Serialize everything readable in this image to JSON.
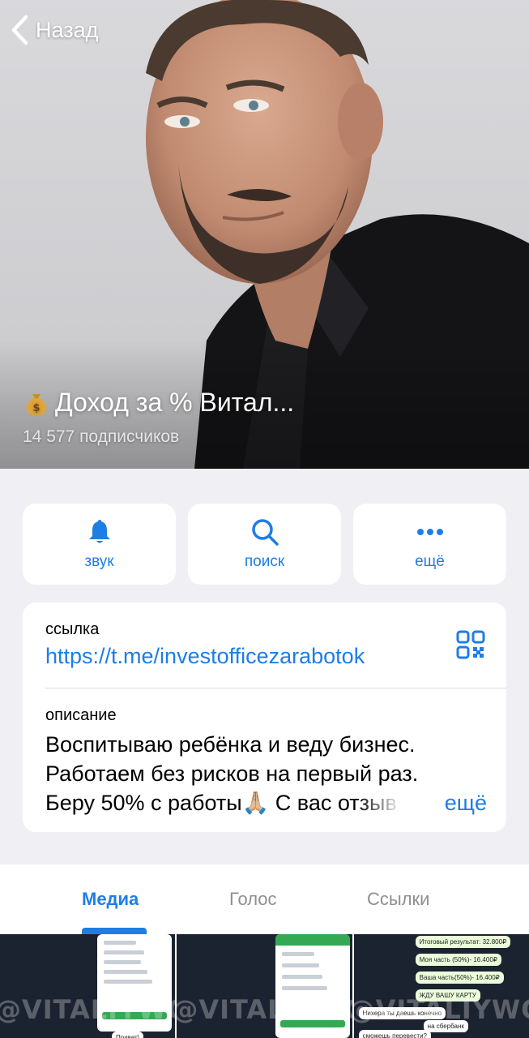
{
  "nav": {
    "back_label": "Назад"
  },
  "channel": {
    "title": "Доход за % Витал...",
    "subscribers": "14 577 подписчиков",
    "title_emoji": "money-bag-icon"
  },
  "actions": [
    {
      "label": "звук",
      "icon": "bell-icon"
    },
    {
      "label": "поиск",
      "icon": "search-icon"
    },
    {
      "label": "ещё",
      "icon": "more-dots-icon"
    }
  ],
  "info": {
    "link_caption": "ссылка",
    "link": "https://t.me/investofficezarabotok",
    "description_caption": "описание",
    "description_lines": [
      "Воспитываю ребёнка и веду бизнес.",
      "Работаем без рисков на первый раз.",
      "Беру 50% с работы🙏🏼 С вас отзыв"
    ],
    "more_label": "ещё"
  },
  "tabs": [
    {
      "label": "Медиа",
      "active": true
    },
    {
      "label": "Голос",
      "active": false
    },
    {
      "label": "Ссылки",
      "active": false
    }
  ],
  "media": {
    "watermark": "@VITALIYWORK",
    "thumb3_lines": [
      "Итоговый результат: 32.800₽",
      "Моя часть (50%)- 16.400₽",
      "Ваша часть(50%)- 16.400₽",
      "ЖДУ ВАШУ КАРТУ",
      "Нихера ты даешь конечно",
      "на сбербанк",
      "сможешь перевести?"
    ],
    "thumb1_bubble": "Привет!"
  },
  "colors": {
    "accent": "#1d7ee6",
    "background": "#efeff4",
    "card": "#ffffff",
    "muted": "#8e8e93"
  }
}
